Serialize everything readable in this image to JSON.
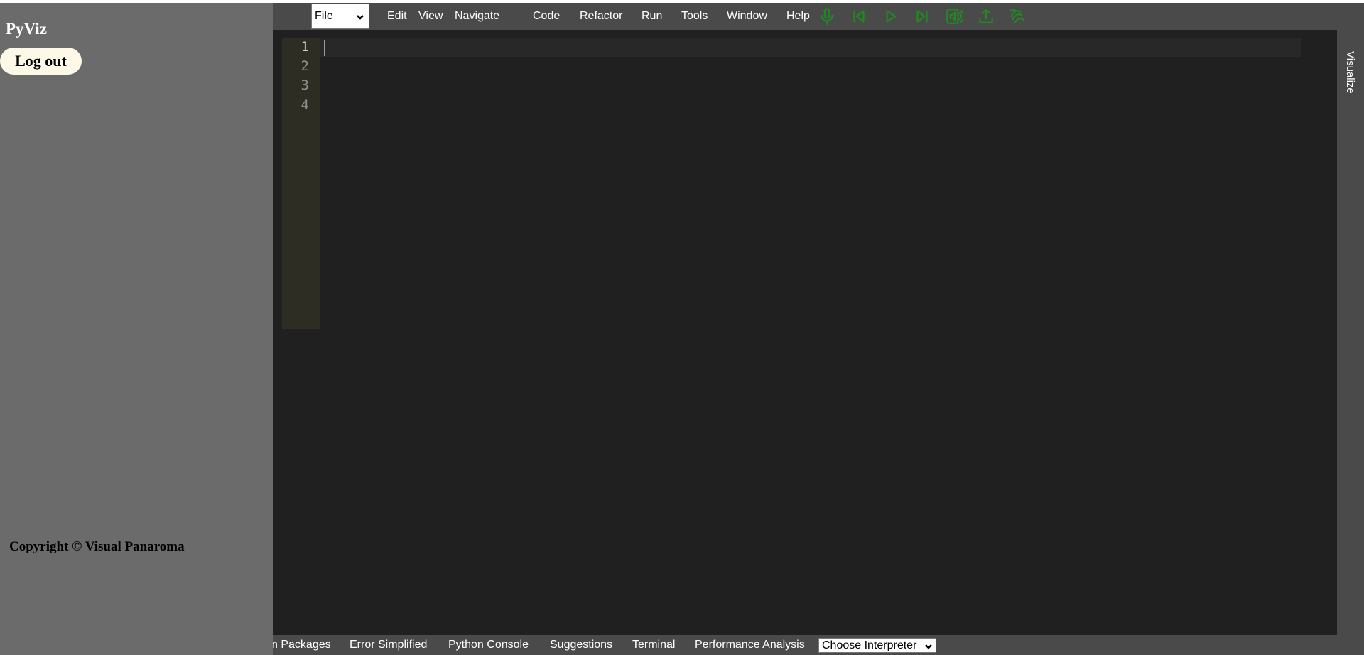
{
  "sidebar": {
    "brand": "PyViz",
    "logout_label": "Log out",
    "copyright": "Copyright © Visual Panaroma"
  },
  "menubar": {
    "file_select": "File",
    "items": [
      "Edit",
      "View",
      "Navigate",
      "Code",
      "Refactor",
      "Run",
      "Tools",
      "Window",
      "Help"
    ],
    "tools": [
      "microphone-icon",
      "step-back-icon",
      "play-icon",
      "step-forward-icon",
      "speak-icon",
      "upload-icon",
      "gesture-icon"
    ]
  },
  "editor": {
    "line_numbers": [
      "1",
      "2",
      "3",
      "4"
    ]
  },
  "side_tab": {
    "label": "Visualize"
  },
  "bottom": {
    "tabs": [
      "n Packages",
      "Error Simplified",
      "Python Console",
      "Suggestions",
      "Terminal",
      "Performance Analysis"
    ],
    "interpreter_select": "Choose Interpreter"
  },
  "colors": {
    "sidebar_bg": "#6b6b6b",
    "main_bg": "#4a4a4a",
    "editor_bg": "#202020",
    "icon_green": "#1f8a1f",
    "logout_bg": "#fdf8e8"
  }
}
